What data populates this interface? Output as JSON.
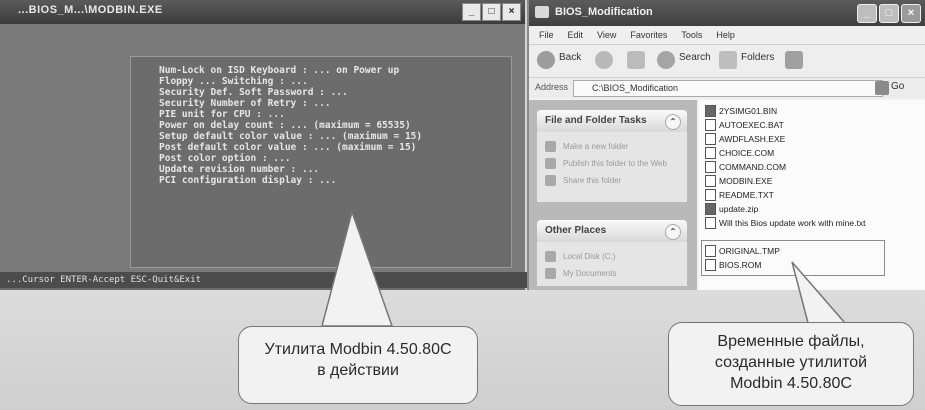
{
  "console": {
    "title": "...BIOS_M...\\MODBIN.EXE",
    "controls": [
      "_",
      "□",
      "×"
    ],
    "lines": [
      "Num-Lock on ISD Keyboard : ... on Power up",
      "Floppy ... Switching : ...",
      "Security Def. Soft Password : ...",
      "Security Number of Retry : ...",
      "PIE unit for CPU : ...",
      "Power on delay count : ... (maximum = 65535)",
      "Setup default color value : ... (maximum = 15)",
      "Post default color value : ... (maximum = 15)",
      "Post color option : ...",
      "Update revision number : ...",
      "PCI configuration display : ..."
    ],
    "status": "...Cursor ENTER-Accept ESC-Quit&Exit"
  },
  "explorer": {
    "title": "BIOS_Modification",
    "controls": [
      "_",
      "□",
      "×"
    ],
    "menu": [
      "File",
      "Edit",
      "View",
      "Favorites",
      "Tools",
      "Help"
    ],
    "toolbar": {
      "back": "Back",
      "search": "Search",
      "folders": "Folders"
    },
    "address": {
      "label": "Address",
      "value": "C:\\BIOS_Modification",
      "go": "Go"
    },
    "tasks_panel": {
      "title": "File and Folder Tasks",
      "items": [
        "Make a new folder",
        "Publish this folder to the Web",
        "Share this folder"
      ]
    },
    "other_panel": {
      "title": "Other Places",
      "items": [
        "Local Disk (C:)",
        "My Documents"
      ]
    },
    "files": [
      "2YSIMG01.BIN",
      "AUTOEXEC.BAT",
      "AWDFLASH.EXE",
      "CHOICE.COM",
      "COMMAND.COM",
      "MODBIN.EXE",
      "README.TXT",
      "update.zip",
      "Will this Bios update work with mine.txt",
      "ORIGINAL.TMP",
      "BIOS.ROM"
    ]
  },
  "callouts": {
    "left": [
      "Утилита Modbin 4.50.80C",
      "в действии"
    ],
    "right": [
      "Временные файлы,",
      "созданные утилитой",
      "Modbin 4.50.80C"
    ]
  }
}
